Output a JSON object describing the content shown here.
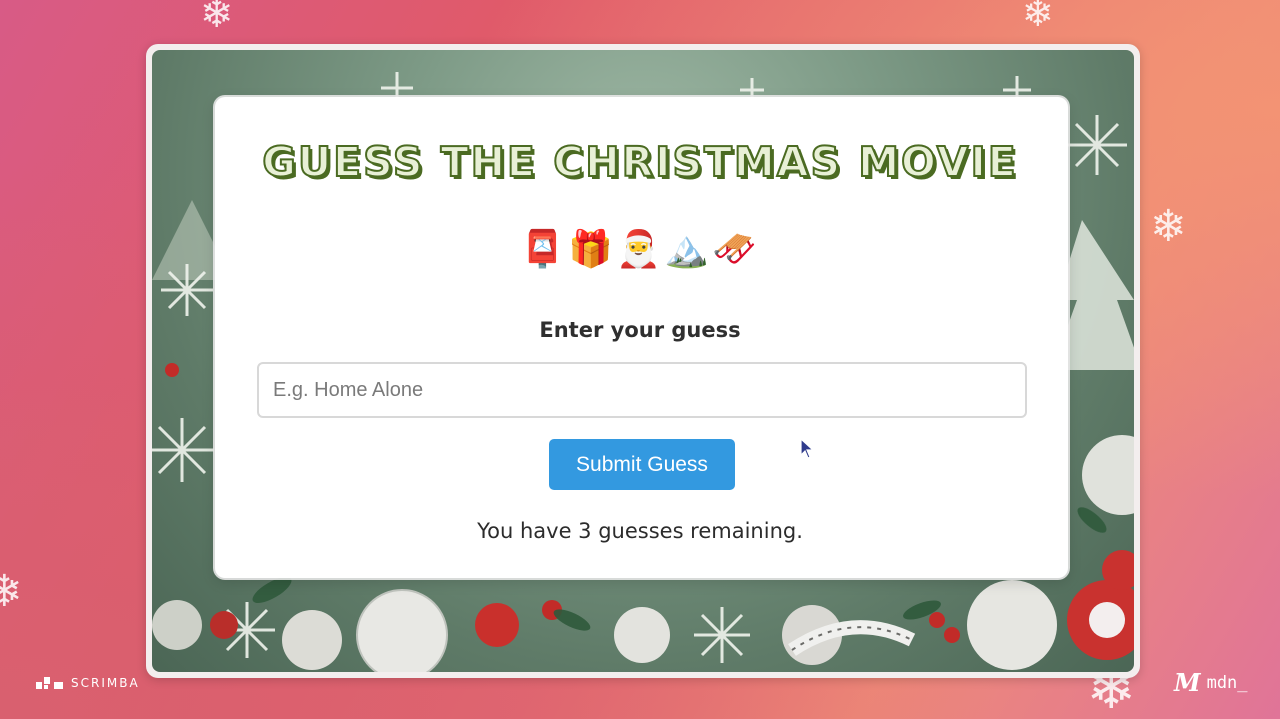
{
  "game": {
    "title": "Guess the Christmas Movie",
    "emojis": [
      "📮",
      "🎁",
      "🎅",
      "🏔️",
      "🛷"
    ],
    "input_label": "Enter your guess",
    "input_placeholder": "E.g. Home Alone",
    "input_value": "",
    "submit_label": "Submit Guess",
    "remaining_text": "You have 3 guesses remaining."
  },
  "branding": {
    "left": "SCRIMBA",
    "right_logo": "M",
    "right_text": "mdn_"
  },
  "colors": {
    "accent_button": "#3399e0",
    "title_green": "#4b6b22",
    "background_pink": "#e05a6a"
  },
  "icons": {
    "cursor": "mouse-pointer-icon",
    "decoration": "snowflake-icon"
  }
}
